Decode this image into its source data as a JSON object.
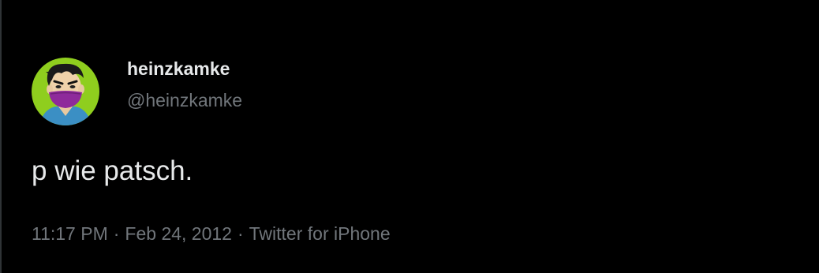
{
  "tweet": {
    "author": {
      "display_name": "heinzkamke",
      "handle": "@heinzkamke",
      "avatar_icon": "cartoon-avatar-masked-face"
    },
    "text": "p wie patsch.",
    "meta": {
      "time": "11:17 PM",
      "separator": "·",
      "date": "Feb 24, 2012",
      "source": "Twitter for iPhone"
    }
  },
  "colors": {
    "background": "#000000",
    "primary_text": "#e7e9ea",
    "secondary_text": "#71767b",
    "avatar_background": "#8fce1e",
    "mask": "#8e2a9b"
  }
}
